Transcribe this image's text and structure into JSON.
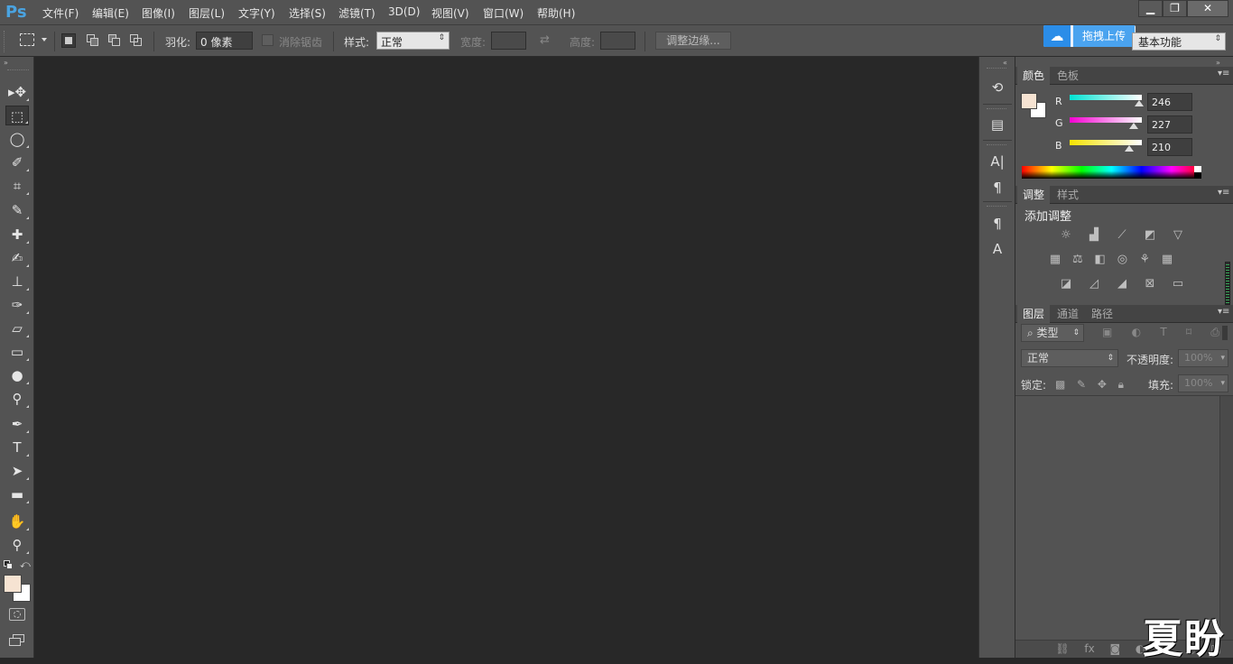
{
  "app": {
    "logo": "Ps"
  },
  "menu": [
    {
      "label": "文件(F)"
    },
    {
      "label": "编辑(E)"
    },
    {
      "label": "图像(I)"
    },
    {
      "label": "图层(L)"
    },
    {
      "label": "文字(Y)"
    },
    {
      "label": "选择(S)"
    },
    {
      "label": "滤镜(T)"
    },
    {
      "label": "3D(D)"
    },
    {
      "label": "视图(V)"
    },
    {
      "label": "窗口(W)"
    },
    {
      "label": "帮助(H)"
    }
  ],
  "window_controls": {
    "minimize": "▁",
    "restore": "❐",
    "close": "✕"
  },
  "upload": {
    "label": "拖拽上传"
  },
  "workspace": {
    "value": "基本功能"
  },
  "options": {
    "feather_label": "羽化:",
    "feather_value": "0 像素",
    "antialias_label": "消除锯齿",
    "style_label": "样式:",
    "style_value": "正常",
    "width_label": "宽度:",
    "height_label": "高度:",
    "refine_edge": "调整边缘..."
  },
  "tools": [
    {
      "name": "move-tool",
      "glyph": "▸✥"
    },
    {
      "name": "rect-marquee-tool",
      "glyph": "⬚"
    },
    {
      "name": "lasso-tool",
      "glyph": "◯"
    },
    {
      "name": "quick-select-tool",
      "glyph": "✐"
    },
    {
      "name": "crop-tool",
      "glyph": "⌗"
    },
    {
      "name": "eyedropper-tool",
      "glyph": "✎"
    },
    {
      "name": "healing-brush-tool",
      "glyph": "✚"
    },
    {
      "name": "brush-tool",
      "glyph": "✍"
    },
    {
      "name": "clone-stamp-tool",
      "glyph": "⊥"
    },
    {
      "name": "history-brush-tool",
      "glyph": "✑"
    },
    {
      "name": "eraser-tool",
      "glyph": "▱"
    },
    {
      "name": "gradient-tool",
      "glyph": "▭"
    },
    {
      "name": "blur-tool",
      "glyph": "●"
    },
    {
      "name": "dodge-tool",
      "glyph": "⚲"
    },
    {
      "name": "pen-tool",
      "glyph": "✒"
    },
    {
      "name": "type-tool",
      "glyph": "T"
    },
    {
      "name": "path-select-tool",
      "glyph": "➤"
    },
    {
      "name": "rectangle-tool",
      "glyph": "▬"
    },
    {
      "name": "hand-tool",
      "glyph": "✋"
    },
    {
      "name": "zoom-tool",
      "glyph": "⚲"
    }
  ],
  "colors": {
    "foreground": "#f6e3d2",
    "background": "#ffffff",
    "canvas": "#282828",
    "accent": "#4aa3e0"
  },
  "color_panel": {
    "tabs": [
      "颜色",
      "色板"
    ],
    "r_label": "R",
    "g_label": "G",
    "b_label": "B",
    "r": 246,
    "g": 227,
    "b": 210
  },
  "adjust_panel": {
    "tabs": [
      "调整",
      "样式"
    ],
    "title": "添加调整",
    "row1": [
      "brightness-icon",
      "levels-icon",
      "curves-icon",
      "exposure-icon",
      "vibrance-icon"
    ],
    "row2": [
      "hue-sat-icon",
      "color-balance-icon",
      "black-white-icon",
      "photo-filter-icon",
      "channel-mixer-icon",
      "color-lookup-icon"
    ],
    "row3": [
      "invert-icon",
      "posterize-icon",
      "threshold-icon",
      "selective-color-icon",
      "gradient-map-icon"
    ]
  },
  "layers_panel": {
    "tabs": [
      "图层",
      "通道",
      "路径"
    ],
    "filter_label": "类型",
    "blend_mode": "正常",
    "opacity_label": "不透明度:",
    "opacity_value": "100%",
    "lock_label": "锁定:",
    "fill_label": "填充:",
    "fill_value": "100%"
  },
  "watermark": {
    "text": "夏盼"
  }
}
